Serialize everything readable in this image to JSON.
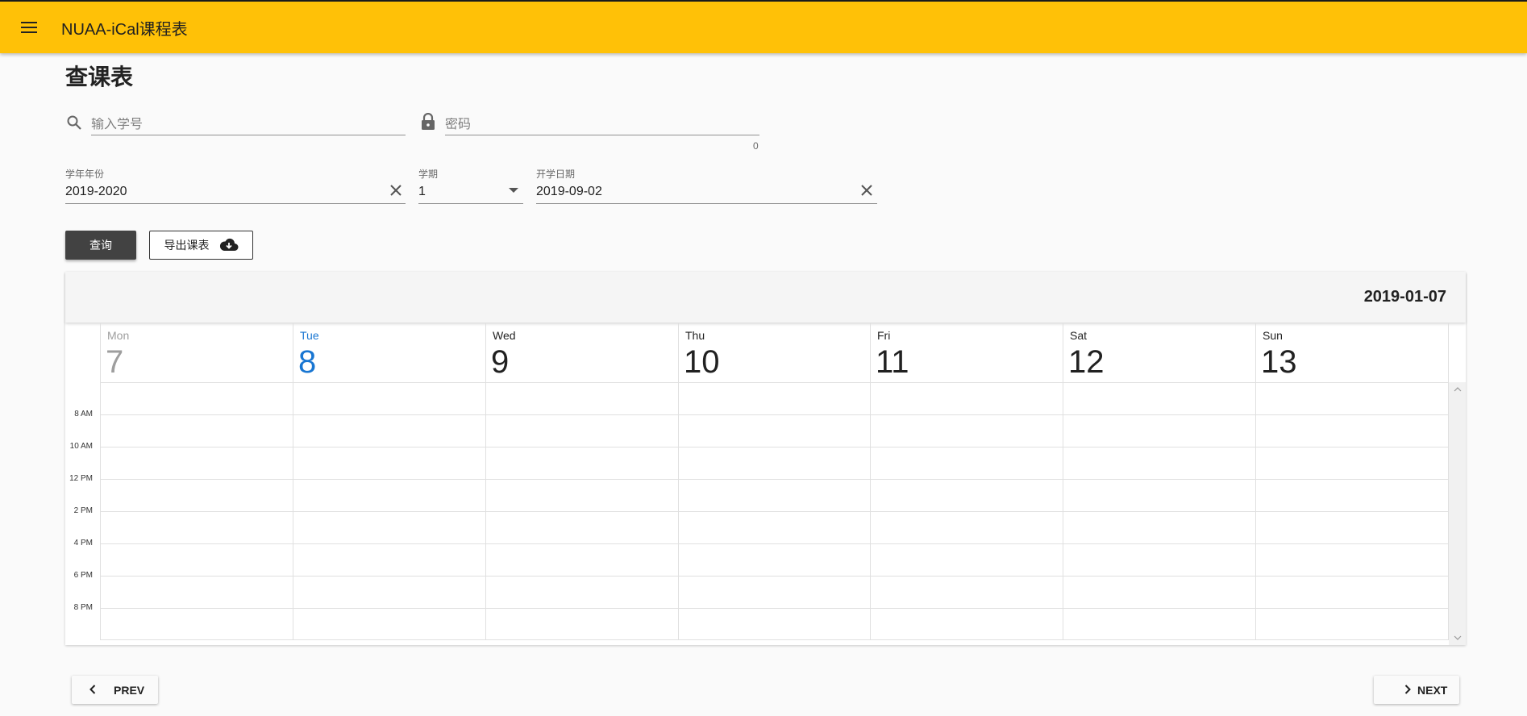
{
  "appbar": {
    "title": "NUAA-iCal课程表",
    "menu_icon": "menu-icon",
    "color": "#ffc107"
  },
  "page": {
    "title": "查课表"
  },
  "login": {
    "student_id_placeholder": "输入学号",
    "student_id_value": "",
    "password_placeholder": "密码",
    "password_value": "",
    "password_counter": "0"
  },
  "filters": {
    "year_label": "学年年份",
    "year_value": "2019-2020",
    "term_label": "学期",
    "term_value": "1",
    "start_label": "开学日期",
    "start_value": "2019-09-02"
  },
  "actions": {
    "query_label": "查询",
    "export_label": "导出课表"
  },
  "calendar": {
    "current_date": "2019-01-07",
    "today_color": "#1976d2",
    "past_color": "#9e9e9e",
    "days": [
      {
        "weekday": "Mon",
        "date": "7",
        "state": "past"
      },
      {
        "weekday": "Tue",
        "date": "8",
        "state": "today"
      },
      {
        "weekday": "Wed",
        "date": "9",
        "state": "future"
      },
      {
        "weekday": "Thu",
        "date": "10",
        "state": "future"
      },
      {
        "weekday": "Fri",
        "date": "11",
        "state": "future"
      },
      {
        "weekday": "Sat",
        "date": "12",
        "state": "future"
      },
      {
        "weekday": "Sun",
        "date": "13",
        "state": "future"
      }
    ],
    "time_labels": [
      "8 AM",
      "10 AM",
      "12 PM",
      "2 PM",
      "4 PM",
      "6 PM",
      "8 PM"
    ]
  },
  "pagination": {
    "prev_label": "PREV",
    "next_label": "NEXT"
  }
}
